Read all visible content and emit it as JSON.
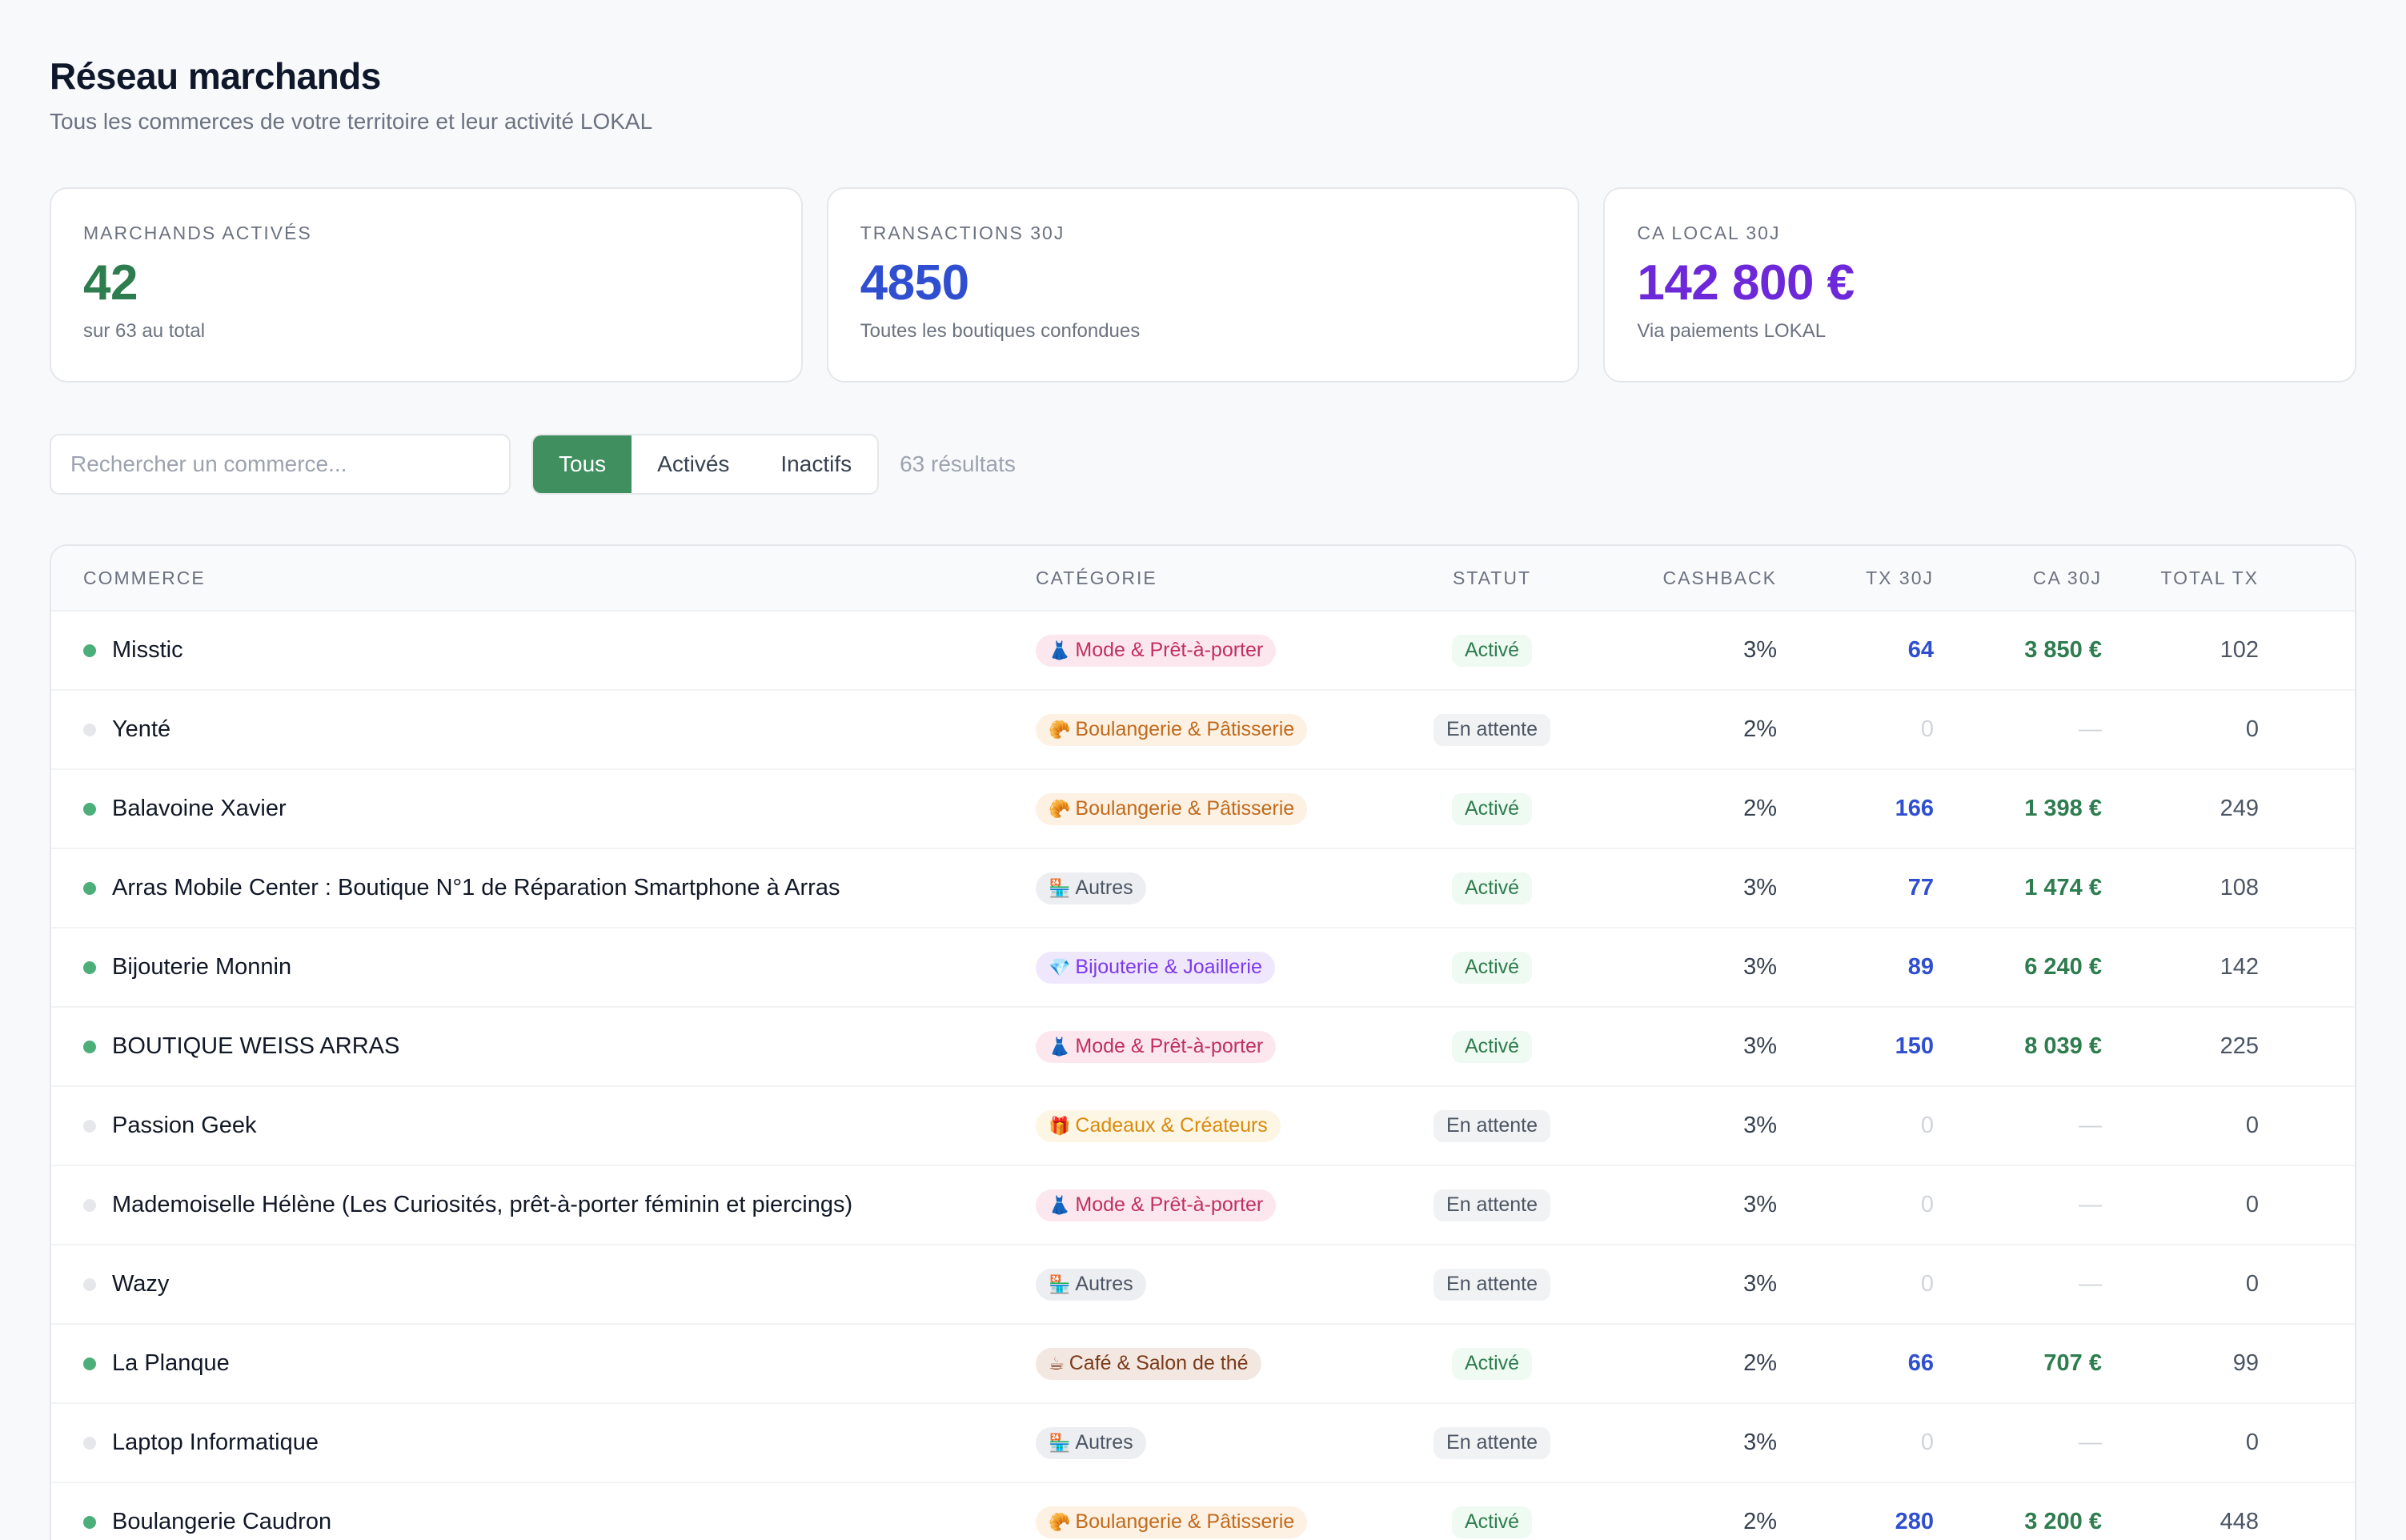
{
  "header": {
    "title": "Réseau marchands",
    "subtitle": "Tous les commerces de votre territoire et leur activité LOKAL"
  },
  "stats": [
    {
      "label": "MARCHANDS ACTIVÉS",
      "value": "42",
      "sub": "sur 63 au total",
      "color": "#2e7d4f"
    },
    {
      "label": "TRANSACTIONS 30J",
      "value": "4850",
      "sub": "Toutes les boutiques confondues",
      "color": "#2f4fd0"
    },
    {
      "label": "CA LOCAL 30J",
      "value": "142 800 €",
      "sub": "Via paiements LOKAL",
      "color": "#6d28d9"
    }
  ],
  "toolbar": {
    "search_placeholder": "Rechercher un commerce...",
    "filters": [
      "Tous",
      "Activés",
      "Inactifs"
    ],
    "active_filter": "Tous",
    "results": "63 résultats"
  },
  "table": {
    "columns": [
      "COMMERCE",
      "CATÉGORIE",
      "STATUT",
      "CASHBACK",
      "TX 30J",
      "CA 30J",
      "TOTAL TX"
    ],
    "rows": [
      {
        "name": "Misstic",
        "active": true,
        "category": "Mode & Prêt-à-porter",
        "cat_type": "mode",
        "cat_icon": "👗",
        "status": "Activé",
        "cashback": "3%",
        "tx": "64",
        "ca": "3 850 €",
        "total": "102"
      },
      {
        "name": "Yenté",
        "active": false,
        "category": "Boulangerie & Pâtisserie",
        "cat_type": "boul",
        "cat_icon": "🥐",
        "status": "En attente",
        "cashback": "2%",
        "tx": "0",
        "ca": "—",
        "total": "0"
      },
      {
        "name": "Balavoine Xavier",
        "active": true,
        "category": "Boulangerie & Pâtisserie",
        "cat_type": "boul",
        "cat_icon": "🥐",
        "status": "Activé",
        "cashback": "2%",
        "tx": "166",
        "ca": "1 398 €",
        "total": "249"
      },
      {
        "name": "Arras Mobile Center : Boutique N°1 de Réparation Smartphone à Arras",
        "active": true,
        "category": "Autres",
        "cat_type": "autre",
        "cat_icon": "🏪",
        "status": "Activé",
        "cashback": "3%",
        "tx": "77",
        "ca": "1 474 €",
        "total": "108"
      },
      {
        "name": "Bijouterie Monnin",
        "active": true,
        "category": "Bijouterie & Joaillerie",
        "cat_type": "bijou",
        "cat_icon": "💎",
        "status": "Activé",
        "cashback": "3%",
        "tx": "89",
        "ca": "6 240 €",
        "total": "142"
      },
      {
        "name": "BOUTIQUE WEISS ARRAS",
        "active": true,
        "category": "Mode & Prêt-à-porter",
        "cat_type": "mode",
        "cat_icon": "👗",
        "status": "Activé",
        "cashback": "3%",
        "tx": "150",
        "ca": "8 039 €",
        "total": "225"
      },
      {
        "name": "Passion Geek",
        "active": false,
        "category": "Cadeaux & Créateurs",
        "cat_type": "cadeau",
        "cat_icon": "🎁",
        "status": "En attente",
        "cashback": "3%",
        "tx": "0",
        "ca": "—",
        "total": "0"
      },
      {
        "name": "Mademoiselle Hélène (Les Curiosités, prêt-à-porter féminin et piercings)",
        "active": false,
        "category": "Mode & Prêt-à-porter",
        "cat_type": "mode",
        "cat_icon": "👗",
        "status": "En attente",
        "cashback": "3%",
        "tx": "0",
        "ca": "—",
        "total": "0"
      },
      {
        "name": "Wazy",
        "active": false,
        "category": "Autres",
        "cat_type": "autre",
        "cat_icon": "🏪",
        "status": "En attente",
        "cashback": "3%",
        "tx": "0",
        "ca": "—",
        "total": "0"
      },
      {
        "name": "La Planque",
        "active": true,
        "category": "Café & Salon de thé",
        "cat_type": "cafe",
        "cat_icon": "☕",
        "status": "Activé",
        "cashback": "2%",
        "tx": "66",
        "ca": "707 €",
        "total": "99"
      },
      {
        "name": "Laptop Informatique",
        "active": false,
        "category": "Autres",
        "cat_type": "autre",
        "cat_icon": "🏪",
        "status": "En attente",
        "cashback": "3%",
        "tx": "0",
        "ca": "—",
        "total": "0"
      },
      {
        "name": "Boulangerie Caudron",
        "active": true,
        "category": "Boulangerie & Pâtisserie",
        "cat_type": "boul",
        "cat_icon": "🥐",
        "status": "Activé",
        "cashback": "2%",
        "tx": "280",
        "ca": "3 200 €",
        "total": "448"
      }
    ]
  }
}
